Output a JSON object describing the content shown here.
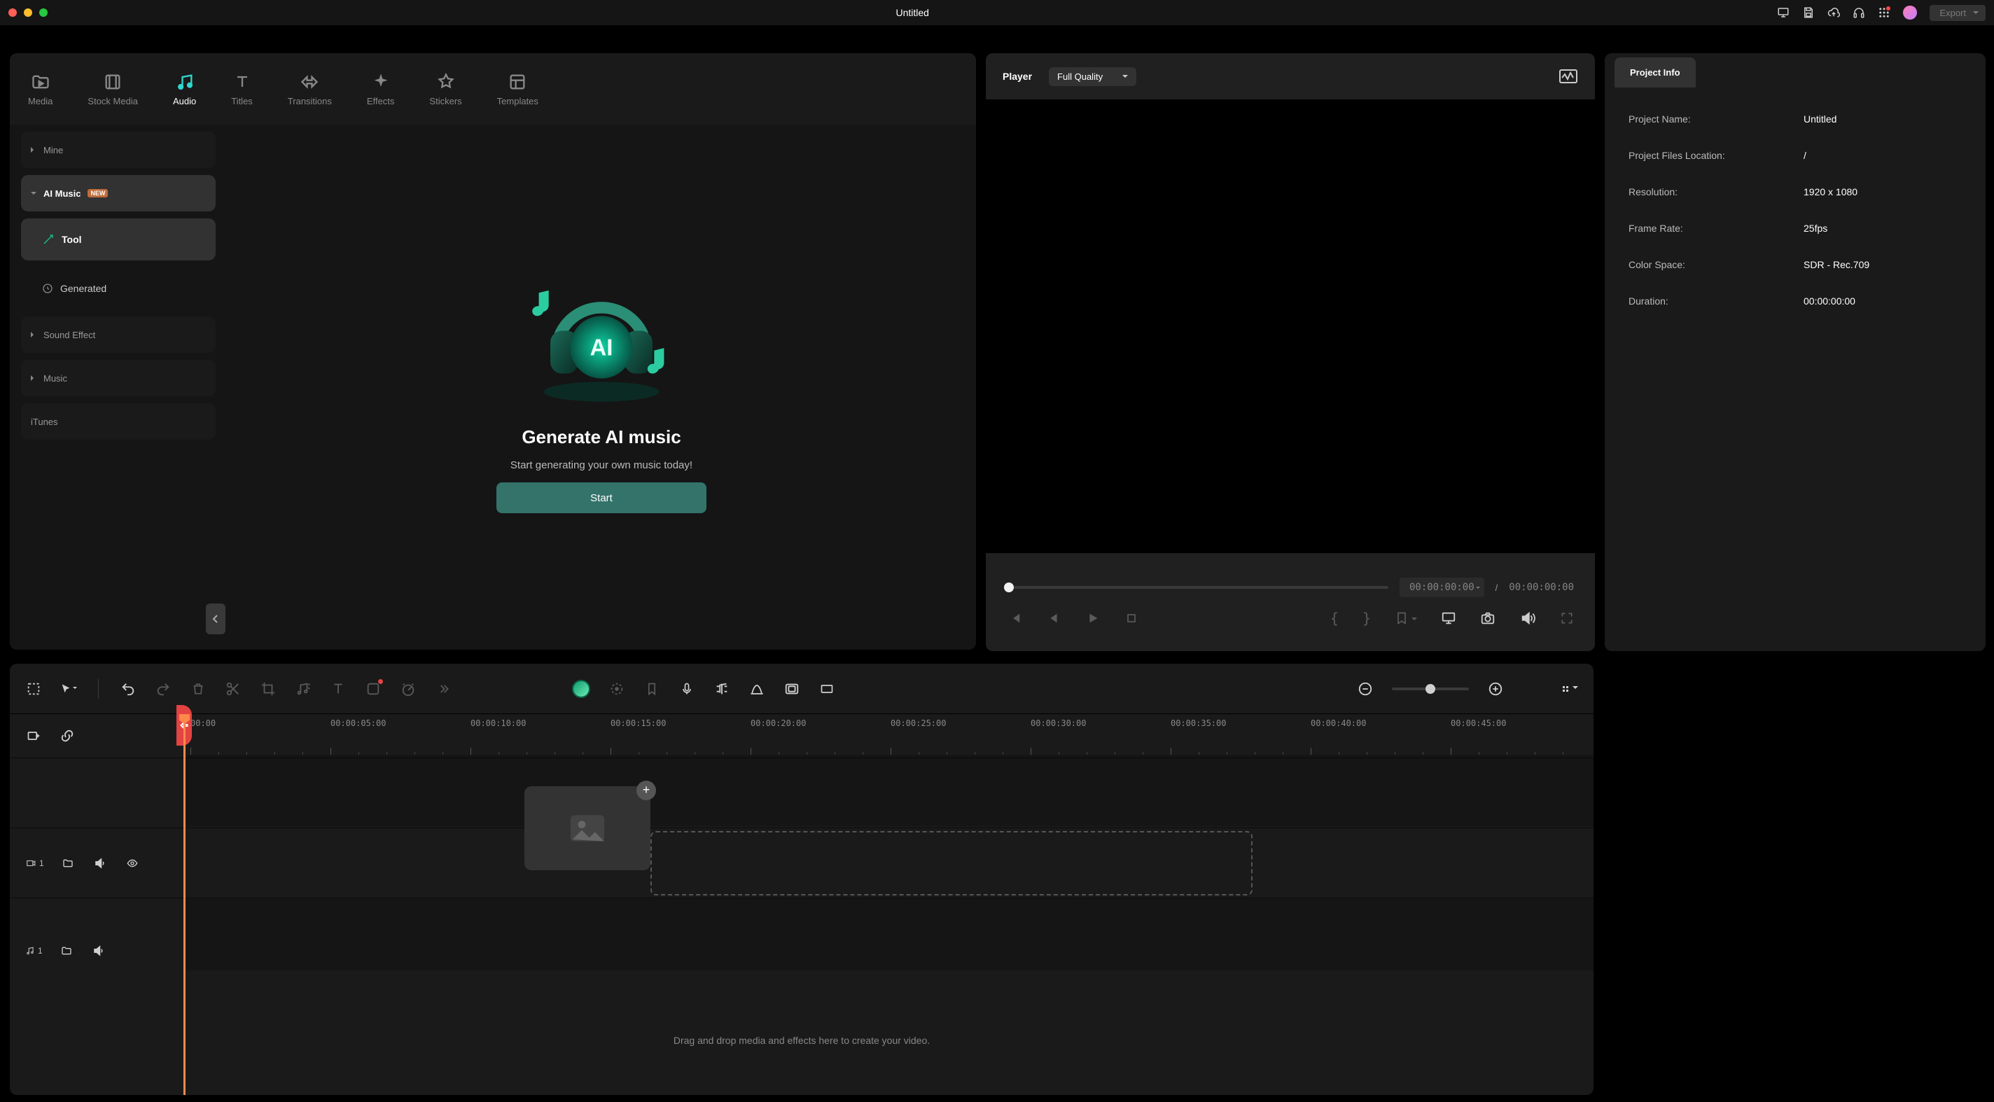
{
  "window_title": "Untitled",
  "export_label": "Export",
  "top_tabs": [
    {
      "label": "Media"
    },
    {
      "label": "Stock Media"
    },
    {
      "label": "Audio"
    },
    {
      "label": "Titles"
    },
    {
      "label": "Transitions"
    },
    {
      "label": "Effects"
    },
    {
      "label": "Stickers"
    },
    {
      "label": "Templates"
    }
  ],
  "sidebar": {
    "items": {
      "mine": "Mine",
      "ai_music": "AI Music",
      "ai_badge": "NEW",
      "tool": "Tool",
      "generated": "Generated",
      "sound_effect": "Sound Effect",
      "music": "Music",
      "itunes": "iTunes"
    }
  },
  "ai": {
    "heading": "Generate AI music",
    "subtitle": "Start generating your own music today!",
    "start": "Start"
  },
  "player": {
    "label": "Player",
    "quality": "Full Quality",
    "current_time": "00:00:00:00",
    "separator": "/",
    "total_time": "00:00:00:00"
  },
  "inspector": {
    "tab": "Project Info",
    "rows": {
      "project_name_k": "Project Name:",
      "project_name_v": "Untitled",
      "location_k": "Project Files Location:",
      "location_v": "/",
      "resolution_k": "Resolution:",
      "resolution_v": "1920 x 1080",
      "frame_rate_k": "Frame Rate:",
      "frame_rate_v": "25fps",
      "color_space_k": "Color Space:",
      "color_space_v": "SDR - Rec.709",
      "duration_k": "Duration:",
      "duration_v": "00:00:00:00"
    }
  },
  "timeline": {
    "track_video_num": "1",
    "track_audio_num": "1",
    "ticks": [
      "00:00",
      "00:00:05:00",
      "00:00:10:00",
      "00:00:15:00",
      "00:00:20:00",
      "00:00:25:00",
      "00:00:30:00",
      "00:00:35:00",
      "00:00:40:00",
      "00:00:45:00"
    ],
    "drop_hint": "Drag and drop media and effects here to create your video."
  }
}
